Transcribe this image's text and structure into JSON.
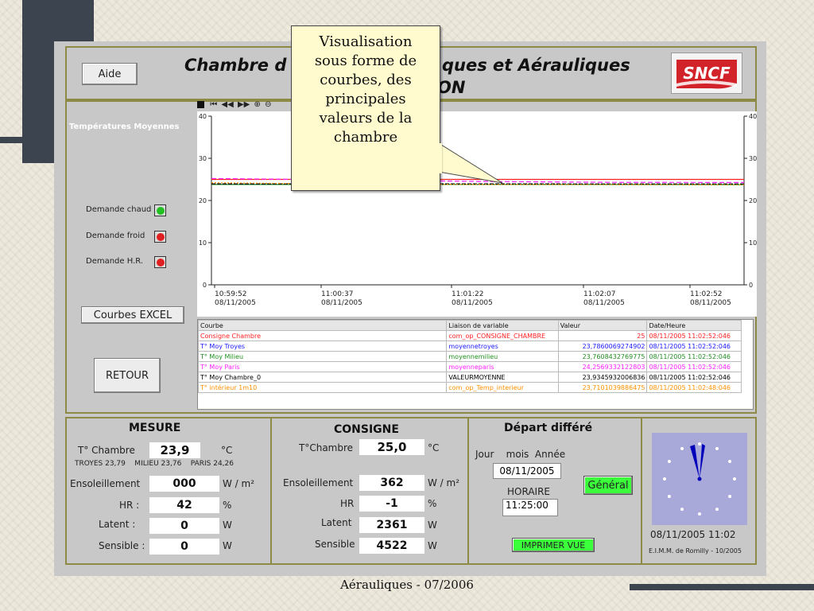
{
  "slide": {
    "footer": "Aérauliques - 07/2006",
    "callout": [
      "Visualisation",
      "sous forme de",
      "courbes, des",
      "principales",
      "valeurs de la",
      "chambre"
    ]
  },
  "header": {
    "help_button": "Aide",
    "title_line1_left": "Chambre d",
    "title_line1_right": "ques et Aérauliques",
    "title_line2": "ON",
    "logo_text": "SNCF"
  },
  "sidebar": {
    "chart_title": "Températures Moyennes",
    "indicators": [
      {
        "label": "Demande chaud",
        "state": "green"
      },
      {
        "label": "Demande froid",
        "state": "red"
      },
      {
        "label": "Demande H.R.",
        "state": "red"
      }
    ],
    "excel_button": "Courbes EXCEL",
    "back_button": "RETOUR"
  },
  "chart_data": {
    "type": "line",
    "y_ticks": [
      "40",
      "30",
      "20",
      "10",
      "0"
    ],
    "ylim": [
      0,
      40
    ],
    "x_ticks": [
      {
        "time": "10:59:52",
        "date": "08/11/2005"
      },
      {
        "time": "11:00:37",
        "date": "08/11/2005"
      },
      {
        "time": "11:01:22",
        "date": "08/11/2005"
      },
      {
        "time": "11:02:07",
        "date": "08/11/2005"
      },
      {
        "time": "11:02:52",
        "date": "08/11/2005"
      }
    ],
    "series": [
      {
        "name": "Consigne Chambre",
        "color": "#ff2020",
        "values": [
          25,
          25,
          25,
          25,
          25
        ]
      },
      {
        "name": "T° Moy Troyes",
        "color": "#1a1aff",
        "values": [
          23.8,
          23.8,
          23.8,
          23.8,
          23.79
        ]
      },
      {
        "name": "T° Moy Milieu",
        "color": "#209020",
        "values": [
          23.8,
          23.8,
          23.8,
          23.8,
          23.76
        ]
      },
      {
        "name": "T° Moy Paris",
        "color": "#ff20ff",
        "values": [
          25.2,
          24.9,
          24.5,
          24.3,
          24.26
        ]
      },
      {
        "name": "T° Moy Chambre_0",
        "color": "#000000",
        "values": [
          23.95,
          23.95,
          23.94,
          23.93,
          23.93
        ]
      },
      {
        "name": "T° intérieur 1m10",
        "color": "#ff9000",
        "values": [
          24.2,
          23.9,
          23.8,
          23.75,
          23.71
        ]
      }
    ]
  },
  "chart_toolbar_icons": [
    "stop-icon",
    "first-icon",
    "rewind-icon",
    "forward-icon",
    "zoom-in-icon",
    "zoom-out-icon"
  ],
  "var_table": {
    "headers": [
      "Courbe",
      "Liaison de variable",
      "Valeur",
      "Date/Heure"
    ],
    "rows": [
      {
        "color": "#ff2020",
        "cells": [
          "Consigne Chambre",
          "com_op_CONSIGNE_CHAMBRE",
          "25",
          "08/11/2005 11:02:52:046"
        ]
      },
      {
        "color": "#1a1aff",
        "cells": [
          "T° Moy Troyes",
          "moyennetroyes",
          "23,7860069274902",
          "08/11/2005 11:02:52:046"
        ]
      },
      {
        "color": "#209020",
        "cells": [
          "T° Moy Milieu",
          "moyennemilieu",
          "23,7608432769775",
          "08/11/2005 11:02:52:046"
        ]
      },
      {
        "color": "#ff20ff",
        "cells": [
          "T° Moy Paris",
          "moyenneparis",
          "24,2569332122803",
          "08/11/2005 11:02:52:046"
        ]
      },
      {
        "color": "#000000",
        "cells": [
          "T° Moy Chambre_0",
          "VALEURMOYENNE",
          "23,9345932006836",
          "08/11/2005 11:02:52:046"
        ]
      },
      {
        "color": "#ff9000",
        "cells": [
          "T° intérieur 1m10",
          "com_op_Temp_interieur",
          "23,7101039886475",
          "08/11/2005 11:02:48:046"
        ]
      }
    ]
  },
  "mesure": {
    "title": "MESURE",
    "temp_label": "T° Chambre",
    "temp_value": "23,9",
    "temp_unit": "°C",
    "sub_readings": "TROYES 23,79    MILIEU 23,76    PARIS 24,26",
    "sun_label": "Ensoleillement",
    "sun_value": "000",
    "sun_unit": "W / m²",
    "hr_label": "HR :",
    "hr_value": "42",
    "hr_unit": "%",
    "latent_label": "Latent :",
    "latent_value": "0",
    "latent_unit": "W",
    "sensible_label": "Sensible :",
    "sensible_value": "0",
    "sensible_unit": "W"
  },
  "consigne": {
    "title": "CONSIGNE",
    "temp_label": "T°Chambre",
    "temp_value": "25,0",
    "temp_unit": "°C",
    "sun_label": "Ensoleillement",
    "sun_value": "362",
    "sun_unit": "W / m²",
    "hr_label": "HR",
    "hr_value": "-1",
    "hr_unit": "%",
    "latent_label": "Latent",
    "latent_value": "2361",
    "latent_unit": "W",
    "sensible_label": "Sensible",
    "sensible_value": "4522",
    "sensible_unit": "W"
  },
  "depart": {
    "title": "Départ différé",
    "date_header": "Jour    mois  Année",
    "date_value": "08/11/2005",
    "time_label": "HORAIRE",
    "time_value": "11:25:00",
    "general_button": "Général",
    "print_button": "IMPRIMER VUE"
  },
  "clock": {
    "datetime": "08/11/2005 11:02",
    "credit": "E.I.M.M. de Romilly - 10/2005"
  }
}
